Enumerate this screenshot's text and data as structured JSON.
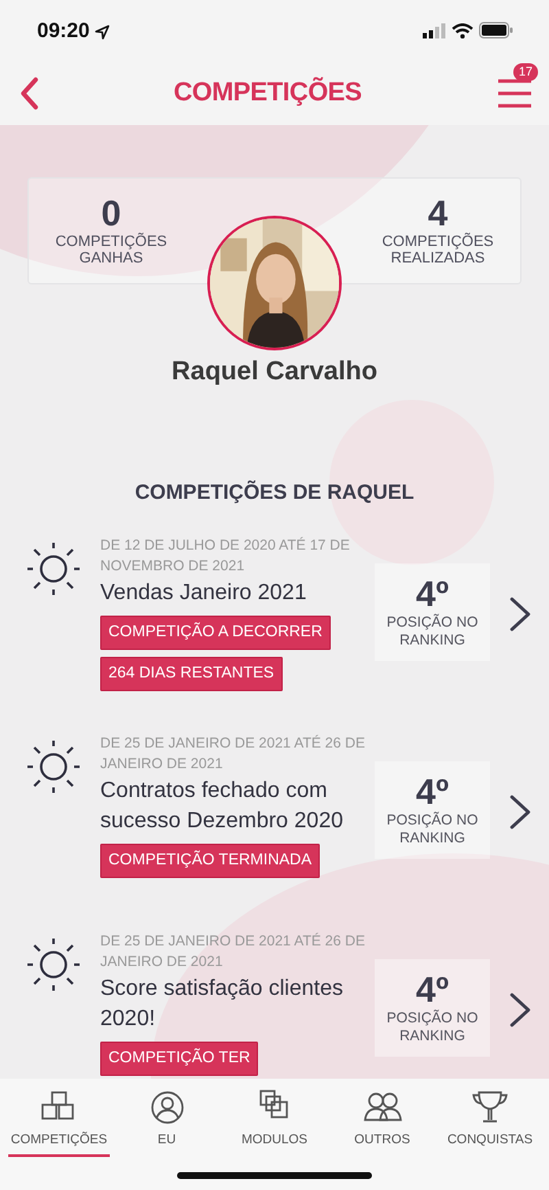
{
  "status_bar": {
    "time": "09:20"
  },
  "header": {
    "title": "COMPETIÇÕES",
    "menu_badge": "17"
  },
  "profile": {
    "stats": [
      {
        "value": "0",
        "label": "COMPETIÇÕES GANHAS"
      },
      {
        "value": "4",
        "label": "COMPETIÇÕES REALIZADAS"
      }
    ],
    "name": "Raquel Carvalho"
  },
  "section_title": "COMPETIÇÕES DE RAQUEL",
  "competitions": [
    {
      "dates": "DE 12 DE JULHO DE 2020 ATÉ 17 DE NOVEMBRO DE 2021",
      "title": "Vendas Janeiro 2021",
      "tags": [
        "COMPETIÇÃO A DECORRER",
        "264 DIAS RESTANTES"
      ],
      "rank": "4º",
      "rank_label": "POSIÇÃO NO RANKING"
    },
    {
      "dates": "DE 25 DE JANEIRO DE 2021 ATÉ 26 DE JANEIRO DE 2021",
      "title": "Contratos fechado com sucesso Dezembro 2020",
      "tags": [
        "COMPETIÇÃO TERMINADA"
      ],
      "rank": "4º",
      "rank_label": "POSIÇÃO NO RANKING"
    },
    {
      "dates": "DE 25 DE JANEIRO DE 2021 ATÉ 26 DE JANEIRO DE 2021",
      "title": "Score satisfação clientes 2020!",
      "tags": [
        "COMPETIÇÃO TER"
      ],
      "rank": "4º",
      "rank_label": "POSIÇÃO NO RANKING"
    }
  ],
  "tab_bar": [
    {
      "kind": "blocks",
      "label": "COMPETIÇÕES",
      "selected": true
    },
    {
      "kind": "person",
      "label": "EU",
      "selected": false
    },
    {
      "kind": "copies",
      "label": "MODULOS",
      "selected": false
    },
    {
      "kind": "people",
      "label": "OUTROS",
      "selected": false
    },
    {
      "kind": "trophy",
      "label": "CONQUISTAS",
      "selected": false
    }
  ]
}
